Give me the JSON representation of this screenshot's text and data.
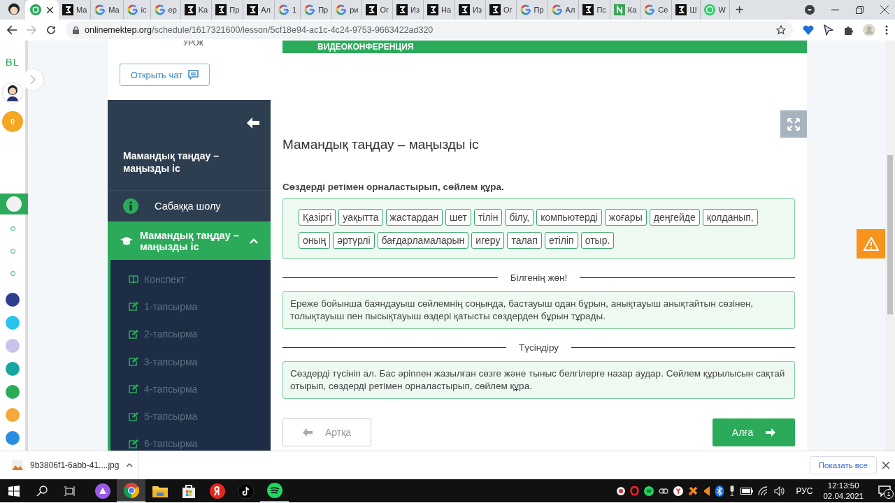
{
  "browser": {
    "tabs": [
      {
        "kind": "avatar",
        "selected": false
      },
      {
        "kind": "bilim",
        "selected": true
      },
      {
        "kind": "zed",
        "title": "Ma",
        "selected": false
      },
      {
        "kind": "google",
        "title": "Ma",
        "selected": false
      },
      {
        "kind": "google",
        "title": "ic",
        "selected": false
      },
      {
        "kind": "google",
        "title": "ep",
        "selected": false
      },
      {
        "kind": "zed",
        "title": "Ka",
        "selected": false
      },
      {
        "kind": "zed",
        "title": "Пр",
        "selected": false
      },
      {
        "kind": "zed",
        "title": "Ал",
        "selected": false
      },
      {
        "kind": "google",
        "title": "1",
        "selected": false
      },
      {
        "kind": "google",
        "title": "Пр",
        "selected": false
      },
      {
        "kind": "google",
        "title": "ри",
        "selected": false
      },
      {
        "kind": "zed",
        "title": "Ог",
        "selected": false
      },
      {
        "kind": "zed",
        "title": "Из",
        "selected": false
      },
      {
        "kind": "zed",
        "title": "На",
        "selected": false
      },
      {
        "kind": "zed",
        "title": "Из",
        "selected": false
      },
      {
        "kind": "zed",
        "title": "Ог",
        "selected": false
      },
      {
        "kind": "google",
        "title": "Пр",
        "selected": false
      },
      {
        "kind": "google",
        "title": "Ал",
        "selected": false
      },
      {
        "kind": "zed",
        "title": "Пс",
        "selected": false
      },
      {
        "kind": "note",
        "title": "Ка",
        "selected": false
      },
      {
        "kind": "google",
        "title": "Се",
        "selected": false
      },
      {
        "kind": "zed",
        "title": "Ш",
        "selected": false
      },
      {
        "kind": "whatsapp",
        "title": "W",
        "selected": false
      }
    ],
    "new_tab": "+",
    "address": {
      "domain": "onlinemektep.org",
      "path": "/schedule/1617321600/lesson/5cf18e94-ac1c-4c24-9753-9663422ad320"
    }
  },
  "rail": {
    "logo": "BL",
    "coins": "0",
    "steps": [
      {
        "selected": true
      },
      {
        "selected": false
      },
      {
        "selected": false
      },
      {
        "selected": false
      }
    ],
    "apps": [
      {
        "color": "#2f3e8f"
      },
      {
        "color": "#29c4ee"
      },
      {
        "color": "#c9c3ea"
      },
      {
        "color": "#17a7a0"
      },
      {
        "color": "#2bab5a"
      },
      {
        "color": "#f5a93a"
      },
      {
        "color": "#2a8de0"
      }
    ]
  },
  "lesson": {
    "heading": "УРОК",
    "chat_button": "Открыть чат",
    "title": "Мамандық таңдау – маңызды іс",
    "nav": [
      {
        "label": "Сабаққа шолу",
        "kind": "info",
        "selected": false
      },
      {
        "label": "Мамандық таңдау – маңызды іс",
        "kind": "cap",
        "selected": true,
        "expanded": true,
        "children": [
          {
            "label": "Конспект",
            "kind": "book"
          },
          {
            "label": "1-тапсырма",
            "kind": "task"
          },
          {
            "label": "2-тапсырма",
            "kind": "task"
          },
          {
            "label": "3-тапсырма",
            "kind": "task"
          },
          {
            "label": "4-тапсырма",
            "kind": "task"
          },
          {
            "label": "5-тапсырма",
            "kind": "task"
          },
          {
            "label": "6-тапсырма",
            "kind": "task"
          }
        ]
      }
    ]
  },
  "main": {
    "banner": "ВИДЕОКОНФЕРЕНЦИЯ",
    "title": "Мамандық таңдау – маңызды іс",
    "instruction": "Сөздерді ретімен орналастырып, сөйлем құра.",
    "words": [
      "Қазіргі",
      "уақытта",
      "жастардан",
      "шет",
      "тілін",
      "білу,",
      "компьютерді",
      "жоғары",
      "деңгейде",
      "қолданып,",
      "оның",
      "әртүрлі",
      "бағдарламаларын",
      "игеру",
      "талап",
      "етіліп",
      "отыр."
    ],
    "sections": [
      {
        "heading": "Білгенің жөн!",
        "text": "Ереже бойынша баяндауыш сөйлемнің соңында, бастауыш одан бұрын, анықтауыш анықтайтын сөзінен, толықтауыш пен пысықтауыш өздері қатысты сөздерден бұрын тұрады."
      },
      {
        "heading": "Түсіндіру",
        "text": "Сөздерді түсініп ал. Бас әріппен жазылған сөзге және тыныс белгілерге назар аудар. Сөйлем құрылысын сақтай отырып, сөздерді ретімен орналастырып, сөйлем құра."
      }
    ],
    "back_button": {
      "label": "Артқа",
      "disabled": true
    },
    "next_button": {
      "label": "Алға"
    }
  },
  "downloads": {
    "file": "9b3806f1-6abb-41....jpg",
    "show_all": "Показать все"
  },
  "taskbar": {
    "apps": [
      {
        "kind": "alice",
        "running": false,
        "selected": false
      },
      {
        "kind": "chrome",
        "running": true,
        "selected": true
      },
      {
        "kind": "explorer",
        "running": false,
        "selected": false
      },
      {
        "kind": "store",
        "running": false,
        "selected": false
      },
      {
        "kind": "yandex",
        "running": false,
        "selected": false
      },
      {
        "kind": "tiktok",
        "running": false,
        "selected": false
      },
      {
        "kind": "spotify",
        "running": true,
        "selected": false
      }
    ],
    "lang": "РУС",
    "time": "12:13:50",
    "date": "02.04.2021",
    "notifications": "1"
  }
}
